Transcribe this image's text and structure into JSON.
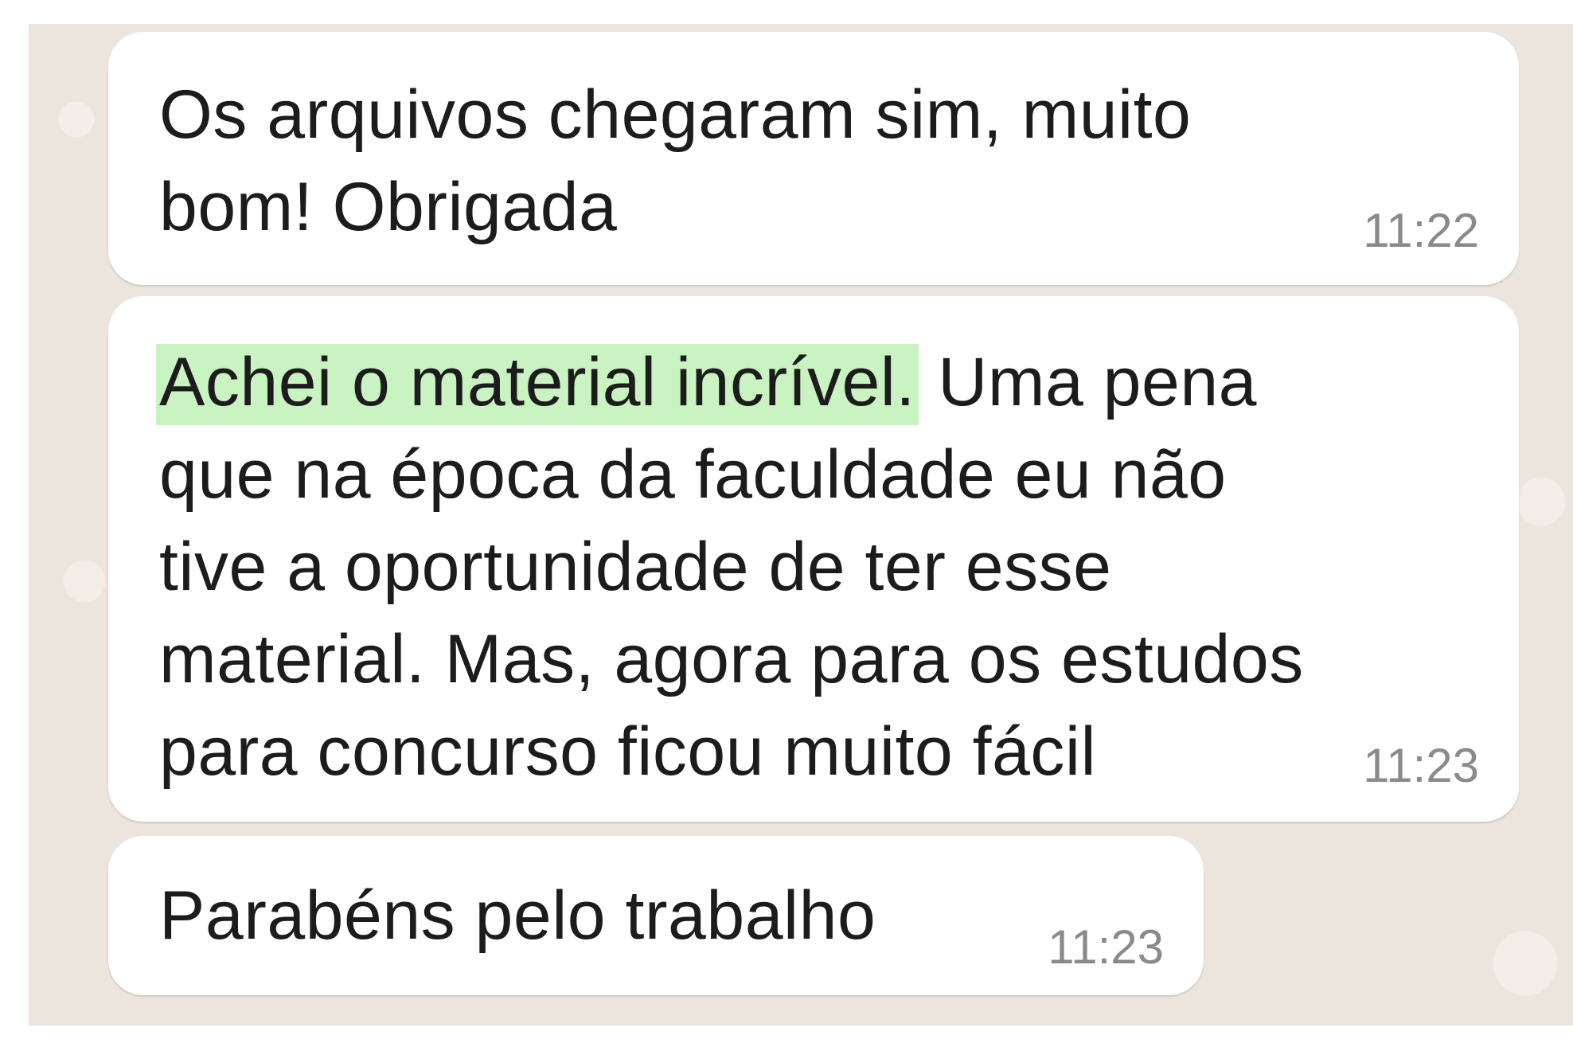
{
  "messages": [
    {
      "text": "Os arquivos chegaram sim, muito\nbom! Obrigada",
      "time": "11:22"
    },
    {
      "highlighted_text": "Achei o material incrível.",
      "text": " Uma pena\nque na época da faculdade eu não\ntive a oportunidade de ter esse\nmaterial. Mas, agora para os estudos\npara concurso ficou muito fácil",
      "time": "11:23"
    },
    {
      "text": "Parabéns pelo trabalho",
      "time": "11:23"
    }
  ],
  "colors": {
    "chat_background": "#ece5dd",
    "bubble": "#ffffff",
    "highlight": "#c9f3c0",
    "timestamp": "#8a8a8a"
  }
}
